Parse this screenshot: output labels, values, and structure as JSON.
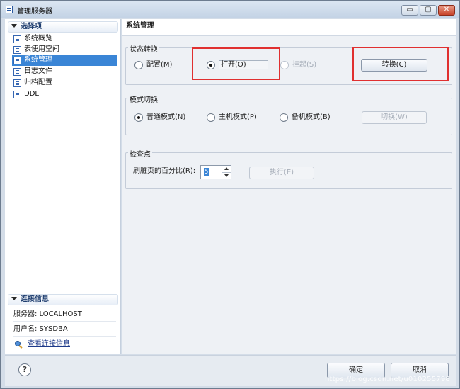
{
  "window": {
    "title": "管理服务器"
  },
  "titlebar_buttons": {
    "minimize": "▭",
    "maximize": "▢",
    "close": "✕"
  },
  "sidebar": {
    "header": "选择项",
    "items": [
      {
        "label": "系统概览",
        "selected": false
      },
      {
        "label": "表使用空间",
        "selected": false
      },
      {
        "label": "系统管理",
        "selected": true
      },
      {
        "label": "日志文件",
        "selected": false
      },
      {
        "label": "归档配置",
        "selected": false
      },
      {
        "label": "DDL",
        "selected": false
      }
    ],
    "connection": {
      "header": "连接信息",
      "server": "服务器: LOCALHOST",
      "user": "用户名: SYSDBA",
      "link": "查看连接信息"
    }
  },
  "main": {
    "title": "系统管理",
    "state_group": {
      "title": "状态转换",
      "options": [
        {
          "label": "配置(M)",
          "checked": false,
          "disabled": false
        },
        {
          "label": "打开(O)",
          "checked": true,
          "disabled": false
        },
        {
          "label": "挂起(S)",
          "checked": false,
          "disabled": true
        }
      ],
      "button": "转换(C)"
    },
    "mode_group": {
      "title": "模式切换",
      "options": [
        {
          "label": "普通模式(N)",
          "checked": true
        },
        {
          "label": "主机模式(P)",
          "checked": false
        },
        {
          "label": "备机模式(B)",
          "checked": false
        }
      ],
      "button": "切换(W)"
    },
    "checkpoint_group": {
      "title": "检查点",
      "label": "刷脏页的百分比(R):",
      "value": "5",
      "button": "执行(E)"
    }
  },
  "footer": {
    "help": "?",
    "ok": "确定",
    "cancel": "取消",
    "watermark": "https://blog.csdn.net/u010255798"
  },
  "colors": {
    "accent": "#3a85d6",
    "highlight_box": "#e03030"
  }
}
